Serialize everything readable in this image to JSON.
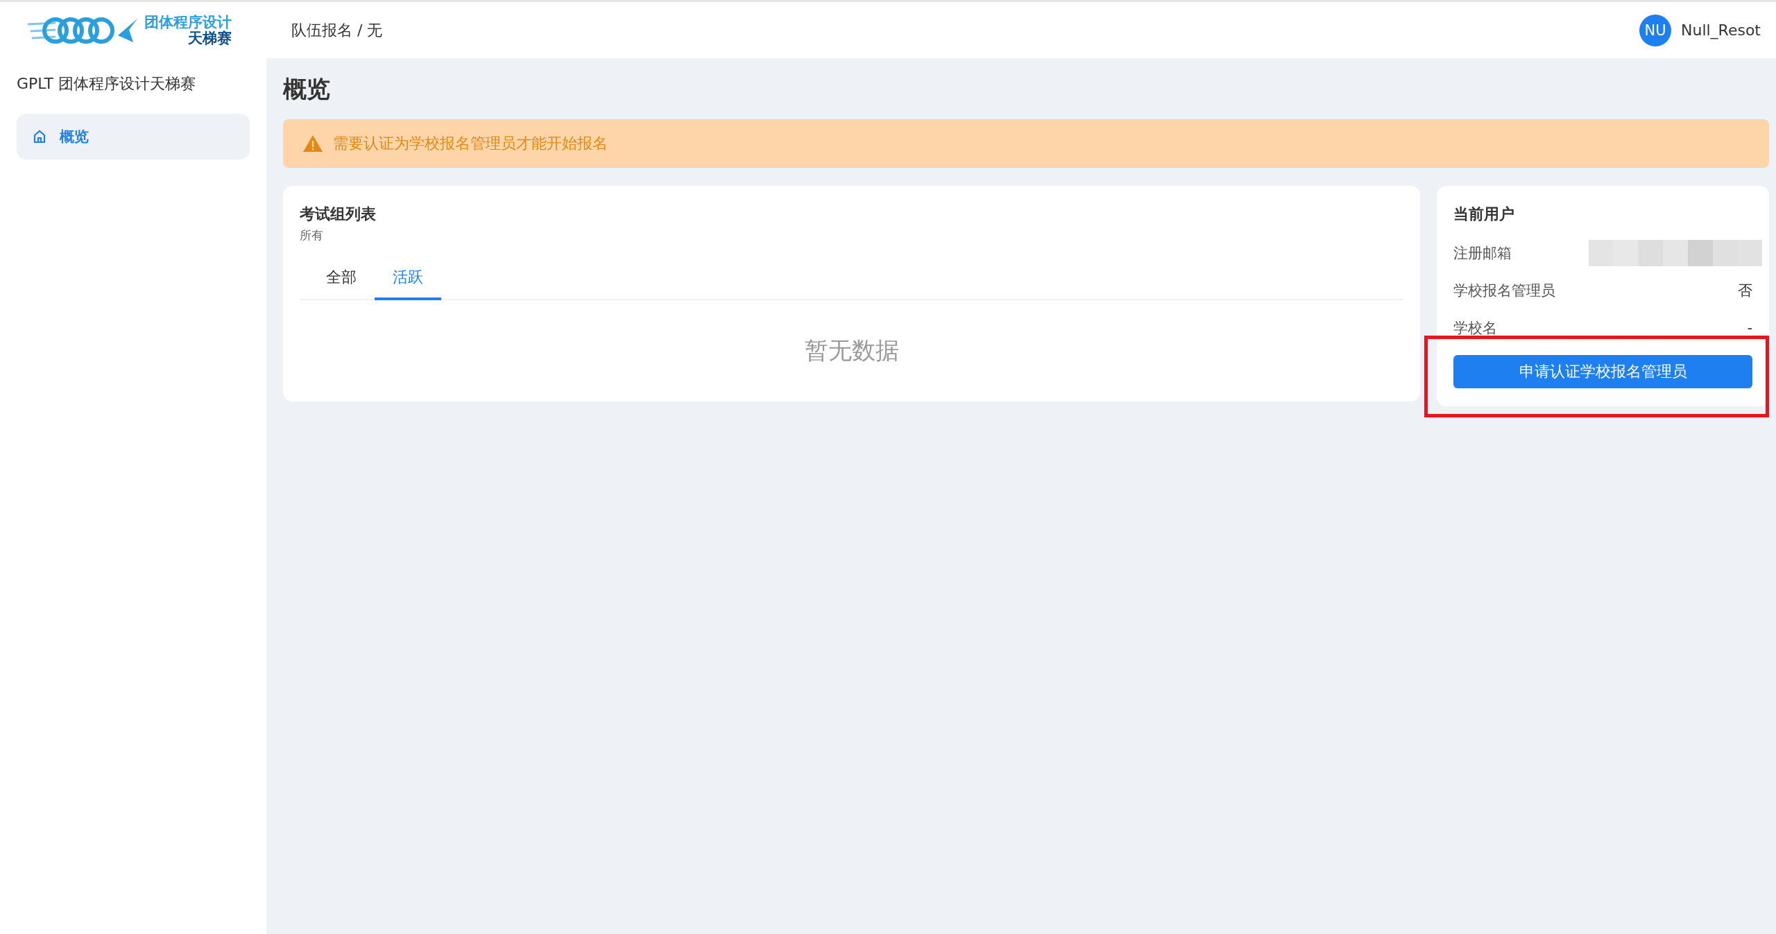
{
  "header": {
    "logo_text": [
      "团体程序设计",
      "天梯赛"
    ],
    "breadcrumb": "队伍报名 / 无",
    "user": {
      "initials": "NU",
      "name": "Null_Resot"
    }
  },
  "sidebar": {
    "title": "GPLT 团体程序设计天梯赛",
    "items": [
      {
        "label": "概览",
        "selected": true
      }
    ]
  },
  "page_title": "概览",
  "alert": {
    "kind": "warning",
    "text": "需要认证为学校报名管理员才能开始报名"
  },
  "exam_groups": {
    "title": "考试组列表",
    "subtitle": "所有",
    "tabs": [
      {
        "label": "全部",
        "selected": false
      },
      {
        "label": "活跃",
        "selected": true
      }
    ],
    "empty_text": "暂无数据"
  },
  "current_user": {
    "title": "当前用户",
    "rows": [
      {
        "label": "注册邮箱",
        "kind": "redacted"
      },
      {
        "label": "学校报名管理员",
        "kind": "text",
        "value": "否"
      },
      {
        "label": "学校名",
        "kind": "text",
        "value": "-"
      }
    ],
    "button": "申请认证学校报名管理员",
    "highlighted": true
  }
}
